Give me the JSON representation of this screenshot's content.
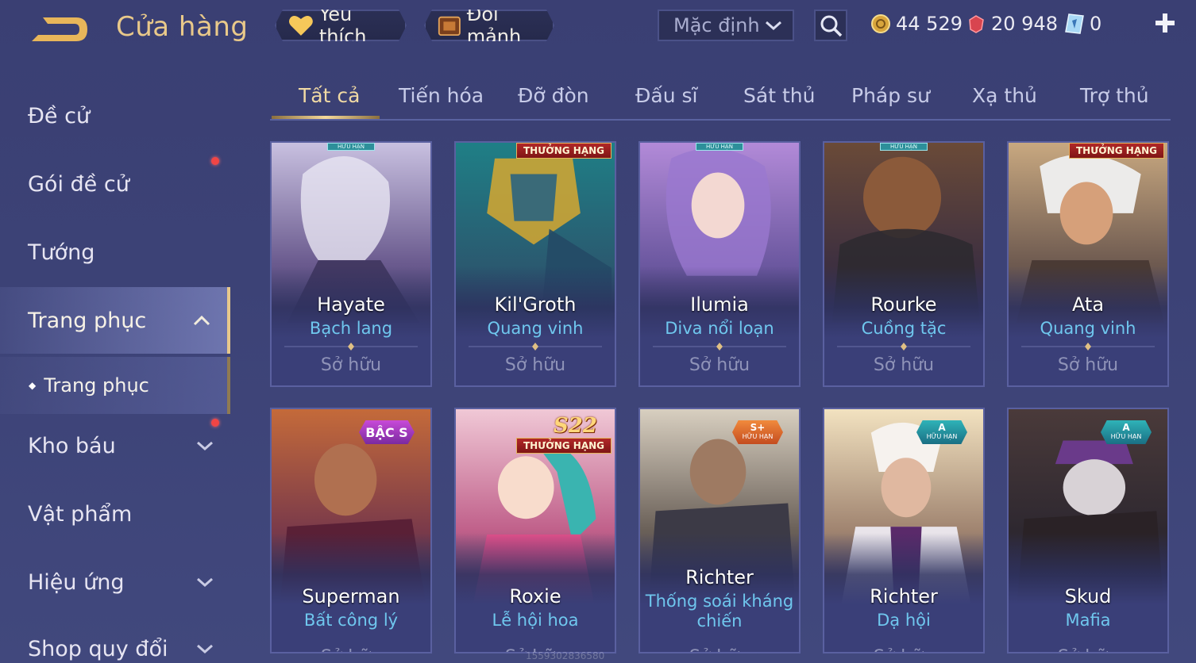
{
  "header": {
    "title": "Cửa hàng",
    "favorites_label": "Yêu thích",
    "fragments_label": "Đổi mảnh",
    "sort_value": "Mặc định",
    "currencies": {
      "gold": "44 529",
      "voucher": "20 948",
      "diamond": "0"
    }
  },
  "sidebar": {
    "items": [
      {
        "label": "Đề cử"
      },
      {
        "label": "Gói đề cử"
      },
      {
        "label": "Tướng"
      },
      {
        "label": "Trang phục"
      },
      {
        "label": "Kho báu"
      },
      {
        "label": "Vật phẩm"
      },
      {
        "label": "Hiệu ứng"
      },
      {
        "label": "Shop quy đổi"
      }
    ],
    "subitem": "Trang phục"
  },
  "tabs": [
    "Tất cả",
    "Tiến hóa",
    "Đỡ đòn",
    "Đấu sĩ",
    "Sát thủ",
    "Pháp sư",
    "Xạ thủ",
    "Trợ thủ"
  ],
  "cards": [
    {
      "hero": "Hayate",
      "skin": "Bạch lang",
      "status": "Sở hữu",
      "badge": "HỮU HẠN"
    },
    {
      "hero": "Kil'Groth",
      "skin": "Quang vinh",
      "status": "Sở hữu",
      "badge": "THƯỞNG HẠNG"
    },
    {
      "hero": "Ilumia",
      "skin": "Diva nổi loạn",
      "status": "Sở hữu",
      "badge": "HỮU HẠN"
    },
    {
      "hero": "Rourke",
      "skin": "Cuồng tặc",
      "status": "Sở hữu",
      "badge": "HỮU HẠN"
    },
    {
      "hero": "Ata",
      "skin": "Quang vinh",
      "status": "Sở hữu",
      "badge": "THƯỞNG HẠNG"
    },
    {
      "hero": "Superman",
      "skin": "Bất công lý",
      "status": "Sở hữu",
      "badge": "BẬC S"
    },
    {
      "hero": "Roxie",
      "skin": "Lễ hội hoa",
      "status": "Sở hữu",
      "badge": "THƯỞNG HẠNG",
      "season": "S22"
    },
    {
      "hero": "Richter",
      "skin": "Thống soái kháng chiến",
      "status": "Sở hữu",
      "badge": "S+",
      "badge_sub": "HỮU HẠN"
    },
    {
      "hero": "Richter",
      "skin": "Dạ hội",
      "status": "Sở hữu",
      "badge": "A",
      "badge_sub": "HỮU HẠN"
    },
    {
      "hero": "Skud",
      "skin": "Mafia",
      "status": "Sở hữu",
      "badge": "A",
      "badge_sub": "HỮU HẠN"
    }
  ],
  "watermark": "1559302836580",
  "colors": {
    "accent_gold": "#e9c98a",
    "skin_name": "#6fc7ee",
    "badge_red": "#b12828",
    "notification": "#f04545"
  }
}
